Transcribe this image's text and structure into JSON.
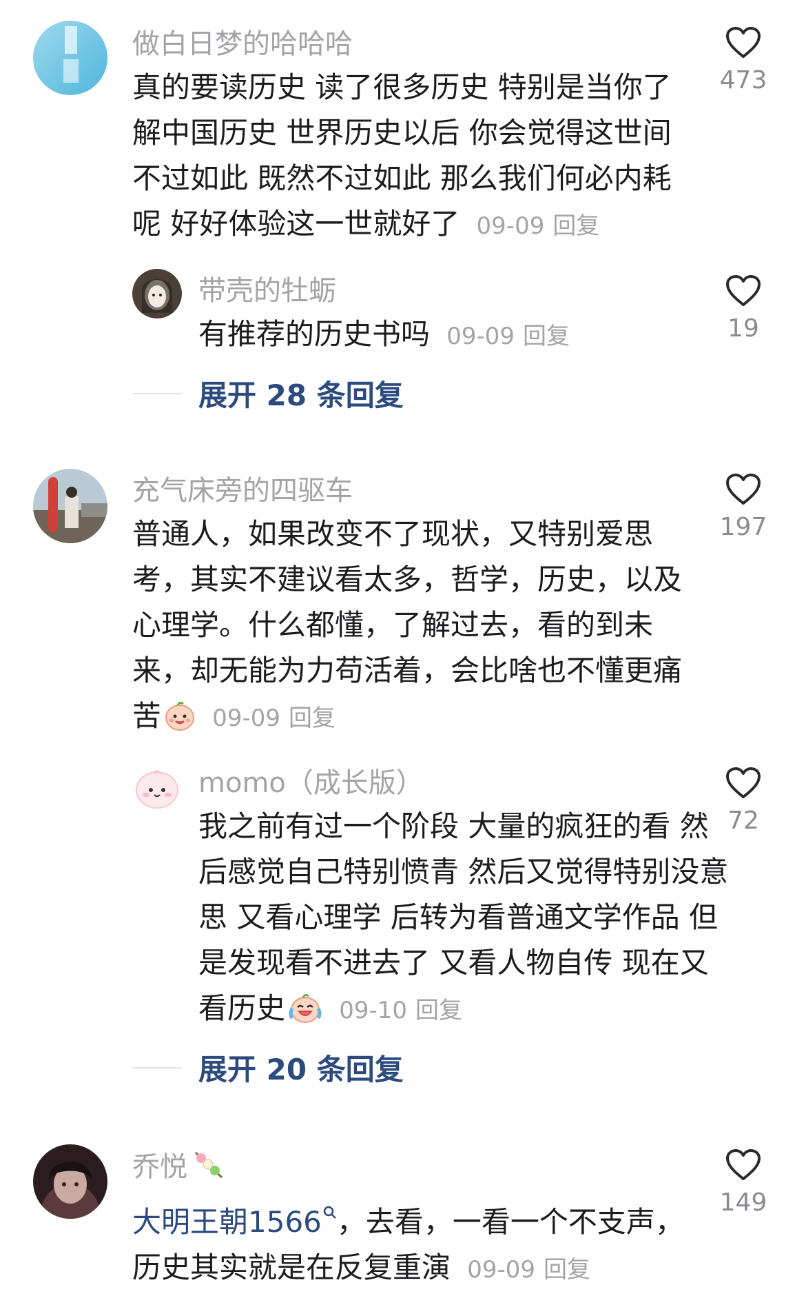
{
  "comments": [
    {
      "username": "做白日梦的哈哈哈",
      "text": "真的要读历史 读了很多历史 特别是当你了解中国历史 世界历史以后 你会觉得这世间不过如此 既然不过如此 那么我们何必内耗呢 好好体验这一世就好了",
      "date": "09-09",
      "reply_label": "回复",
      "likes": "473",
      "replies": [
        {
          "username": "带壳的牡蛎",
          "text": "有推荐的历史书吗",
          "date": "09-09",
          "reply_label": "回复",
          "likes": "19"
        }
      ],
      "expand_label": "展开 28 条回复"
    },
    {
      "username": "充气床旁的四驱车",
      "text": "普通人，如果改变不了现状，又特别爱思考，其实不建议看太多，哲学，历史，以及心理学。什么都懂，了解过去，看的到未来，却无能为力苟活着，会比啥也不懂更痛苦",
      "emoji": "smiling-face-emoji",
      "date": "09-09",
      "reply_label": "回复",
      "likes": "197",
      "replies": [
        {
          "username": "momo（成长版）",
          "text": "我之前有过一个阶段 大量的疯狂的看 然后感觉自己特别愤青 然后又觉得特别没意思 又看心理学 后转为看普通文学作品 但是发现看不进去了 又看人物自传 现在又看历史",
          "emoji": "laughing-crying-emoji",
          "date": "09-10",
          "reply_label": "回复",
          "likes": "72"
        }
      ],
      "expand_label": "展开 20 条回复"
    },
    {
      "username": "乔悦",
      "badge_icon": "skewer-icon",
      "topic_link": "大明王朝1566",
      "text": "，去看，一看一个不支声，历史其实就是在反复重演",
      "date": "09-09",
      "reply_label": "回复",
      "likes": "149"
    }
  ],
  "colors": {
    "username": "#a3a3a8",
    "body": "#1c1c1f",
    "link": "#2c4a7e",
    "like_count": "#8b8b90"
  }
}
